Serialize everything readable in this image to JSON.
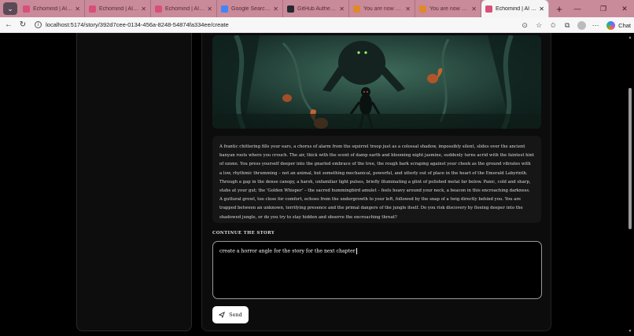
{
  "browser": {
    "tabs": [
      {
        "label": "Echomind | AI Stor",
        "favicon_color": "#d94f7a"
      },
      {
        "label": "Echomind | AI Stor",
        "favicon_color": "#d94f7a"
      },
      {
        "label": "Echomind | AI Stor",
        "favicon_color": "#d94f7a"
      },
      {
        "label": "Google Search - St",
        "favicon_color": "#4285f4"
      },
      {
        "label": "GitHub Authentic",
        "favicon_color": "#24292f"
      },
      {
        "label": "You are now auth",
        "favicon_color": "#e08a2a"
      },
      {
        "label": "You are now auth",
        "favicon_color": "#e08a2a"
      }
    ],
    "active_tab": {
      "label": "Echomind | AI Story",
      "favicon_color": "#d94f7a"
    },
    "url": "localhost:5174/story/392d7cee-0134-456a-8248-54874fa334ee/create",
    "chat_label": "Chat"
  },
  "story": {
    "text": "A frantic chittering fills your ears, a chorus of alarm from the squirrel troop just as a colossal shadow, impossibly silent, slides over the ancient banyan roots where you crouch. The air, thick with the scent of damp earth and blooming night jasmine, suddenly turns acrid with the faintest hint of ozone. You press yourself deeper into the gnarled embrace of the tree, the rough bark scraping against your cheek as the ground vibrates with a low, rhythmic thrumming – not an animal, but something mechanical, powerful, and utterly out of place in the heart of the Emerald Labyrinth. Through a gap in the dense canopy, a harsh, unfamiliar light pulses, briefly illuminating a glint of polished metal far below. Panic, cold and sharp, stabs at your gut; the 'Golden Whisper' – the sacred hummingbird amulet – feels heavy around your neck, a beacon in this encroaching darkness. A guttural growl, too close for comfort, echoes from the undergrowth to your left, followed by the snap of a twig directly behind you. You are trapped between an unknown, terrifying presence and the primal dangers of the jungle itself. Do you risk discovery by fleeing deeper into the shadowed jungle, or do you try to stay hidden and observe the encroaching threat?"
  },
  "continue": {
    "label": "CONTINUE THE STORY",
    "input_value": "create a horror angle for the story for the next chapter",
    "send_label": "Send"
  }
}
